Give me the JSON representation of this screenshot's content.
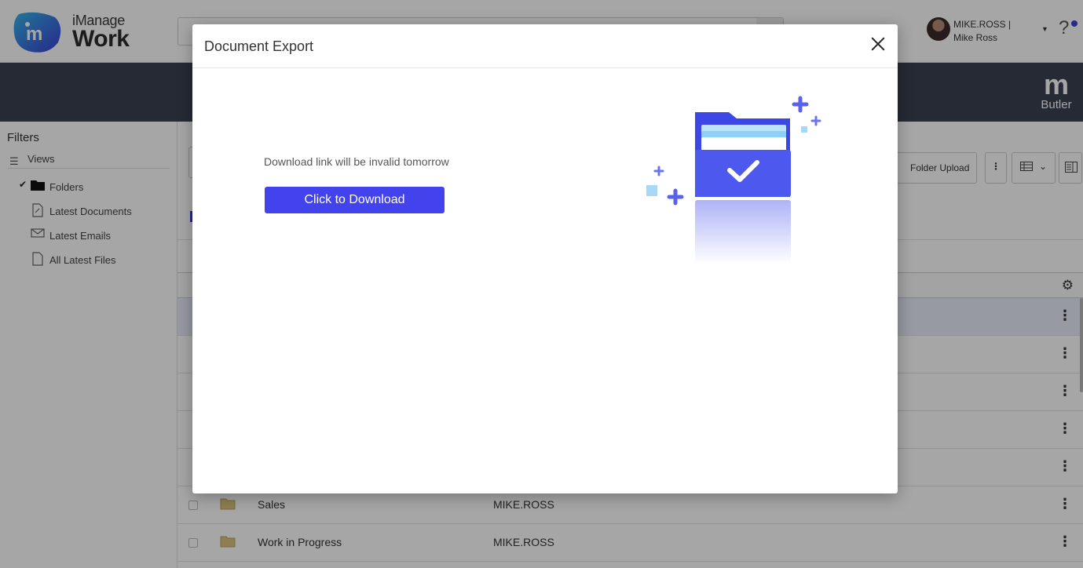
{
  "header": {
    "logo_small": "iManage",
    "logo_big": "Work",
    "user_name": "MIKE.ROSS | Mike Ross",
    "help_symbol": "?"
  },
  "banner": {
    "logo_mark": "m",
    "logo_label": "Butler"
  },
  "filters": {
    "title": "Filters",
    "views_label": "Views",
    "items": [
      {
        "label": "Folders",
        "icon": "folder-icon",
        "checked": true
      },
      {
        "label": "Latest Documents",
        "icon": "document-icon",
        "checked": false
      },
      {
        "label": "Latest Emails",
        "icon": "email-icon",
        "checked": false
      },
      {
        "label": "All Latest Files",
        "icon": "file-icon",
        "checked": false
      }
    ]
  },
  "toolbar": {
    "folder_upload_label": "Folder Upload"
  },
  "table": {
    "rows": [
      {
        "name": "Sales",
        "author": "MIKE.ROSS"
      },
      {
        "name": "Work in Progress",
        "author": "MIKE.ROSS"
      }
    ]
  },
  "modal": {
    "title": "Document Export",
    "message": "Download link will be invalid tomorrow",
    "download_label": "Click to Download"
  },
  "colors": {
    "accent": "#4343ee",
    "banner": "#3a4150",
    "folder_yellow": "#d9c480"
  }
}
